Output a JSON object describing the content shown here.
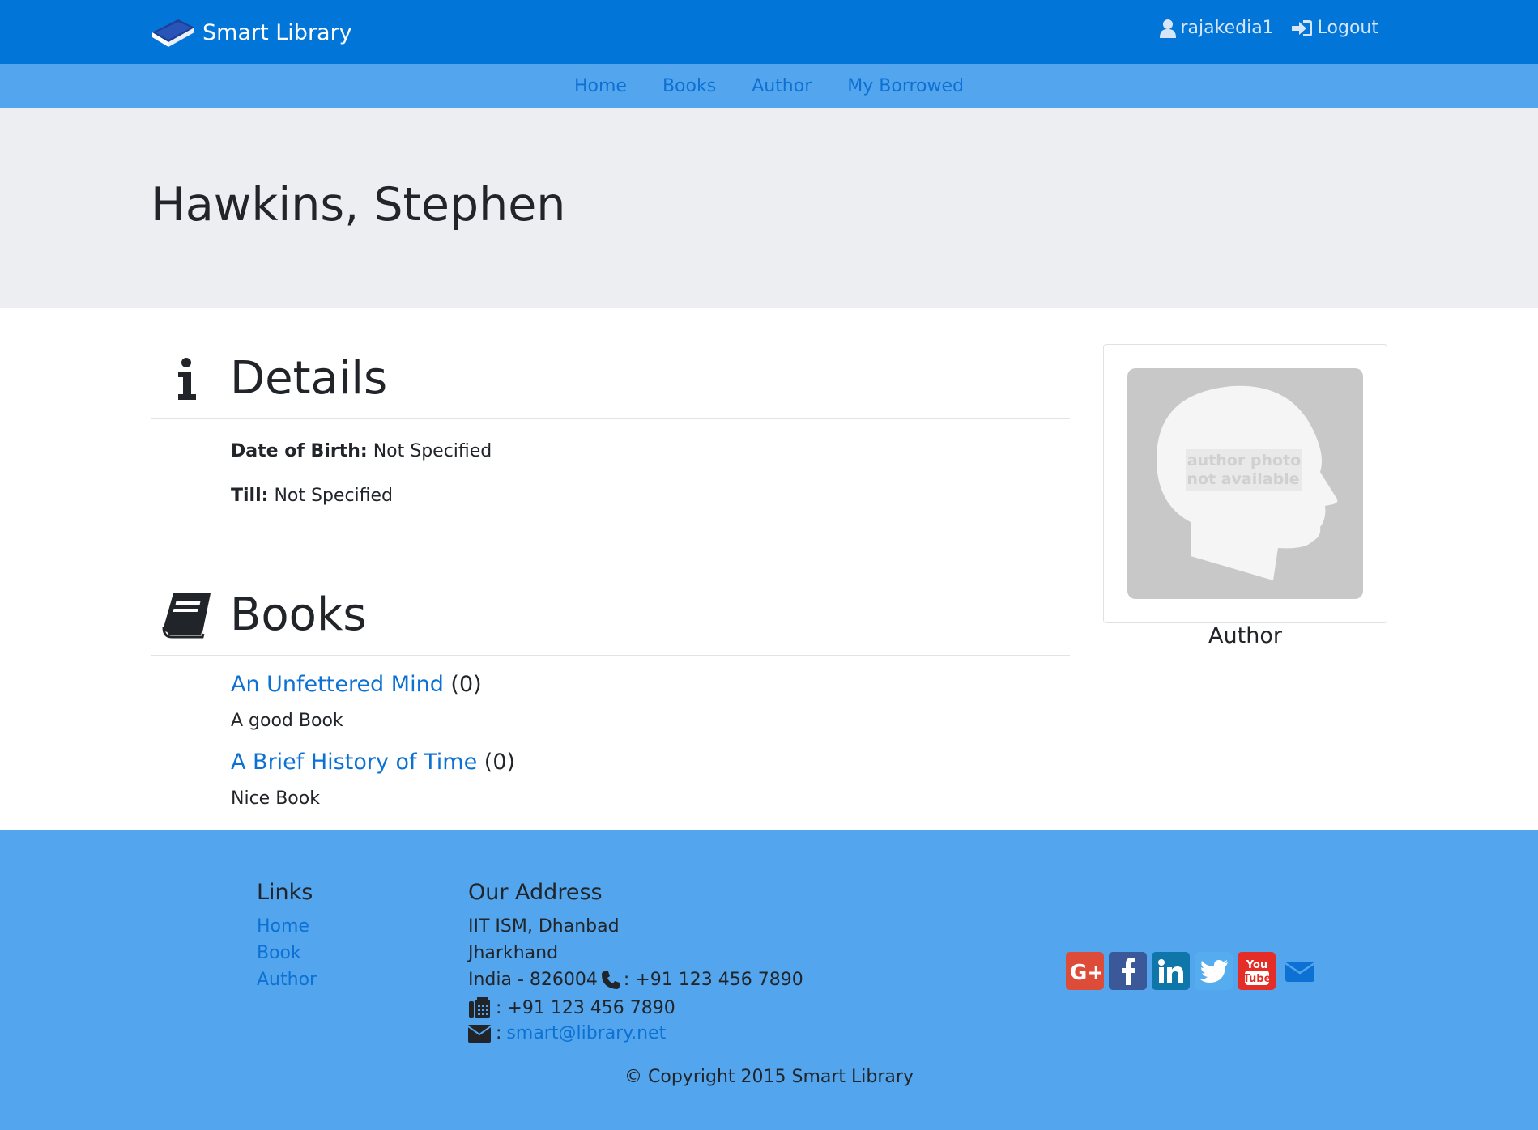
{
  "header": {
    "brand": "Smart Library",
    "username": "rajakedia1",
    "logout_label": "Logout"
  },
  "nav": {
    "items": [
      {
        "label": "Home"
      },
      {
        "label": "Books"
      },
      {
        "label": "Author"
      },
      {
        "label": "My Borrowed"
      }
    ]
  },
  "author": {
    "name": "Hawkins, Stephen",
    "photo_text_line1": "author photo",
    "photo_text_line2": "not available",
    "photo_caption": "Author"
  },
  "details": {
    "heading": "Details",
    "dob_label": "Date of Birth:",
    "dob_value": "Not Specified",
    "till_label": "Till:",
    "till_value": "Not Specified"
  },
  "books": {
    "heading": "Books",
    "items": [
      {
        "title": "An Unfettered Mind",
        "count": "(0)",
        "description": "A good Book"
      },
      {
        "title": "A Brief History of Time",
        "count": "(0)",
        "description": "Nice Book"
      }
    ]
  },
  "footer": {
    "links_title": "Links",
    "links": [
      "Home",
      "Book",
      "Author"
    ],
    "address_title": "Our Address",
    "address_line1": "IIT ISM, Dhanbad",
    "address_line2": "Jharkhand",
    "address_line3": "India - 826004",
    "phone": ": +91 123 456 7890",
    "fax": ": +91 123 456 7890",
    "email_prefix": ":",
    "email": "smart@library.net",
    "copyright": "© Copyright 2015 Smart Library"
  },
  "colors": {
    "header": "#0275d8",
    "subnav": "#53a5ed",
    "link": "#0d71d3",
    "jumbotron": "#eceef1"
  },
  "icons": [
    "book-logo-icon",
    "user-icon",
    "sign-in-icon",
    "info-icon",
    "book-icon",
    "phone-icon",
    "fax-icon",
    "envelope-icon",
    "google-plus-icon",
    "facebook-icon",
    "linkedin-icon",
    "twitter-icon",
    "youtube-icon",
    "mail-icon"
  ]
}
